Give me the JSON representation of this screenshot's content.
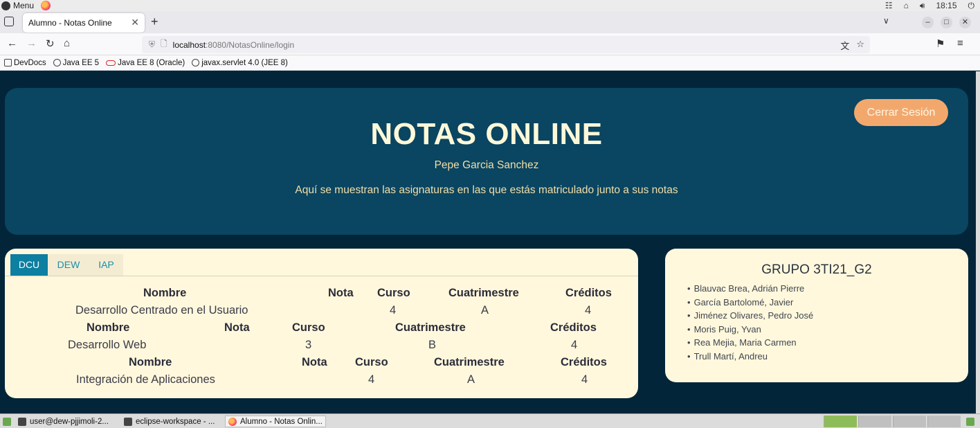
{
  "os": {
    "menu_label": "Menu",
    "time": "18:15"
  },
  "browser": {
    "tab_title": "Alumno - Notas Online",
    "url_host": "localhost",
    "url_rest": ":8080/NotasOnline/login",
    "bookmarks": [
      "DevDocs",
      "Java EE 5",
      "Java EE 8 (Oracle)",
      "javax.servlet 4.0 (JEE 8)"
    ]
  },
  "header": {
    "logout_label": "Cerrar Sesión",
    "title": "NOTAS ONLINE",
    "student_name": "Pepe Garcia Sanchez",
    "description": "Aquí se muestran las asignaturas en las que estás matriculado junto a sus notas"
  },
  "subjects": {
    "tabs": [
      "DCU",
      "DEW",
      "IAP"
    ],
    "active_tab": "DCU",
    "headers": {
      "nombre": "Nombre",
      "nota": "Nota",
      "curso": "Curso",
      "cuatrimestre": "Cuatrimestre",
      "creditos": "Créditos"
    },
    "rows": [
      {
        "nombre": "Desarrollo Centrado en el Usuario",
        "nota": "",
        "curso": "4",
        "cuatrimestre": "A",
        "creditos": "4"
      },
      {
        "nombre": "Desarrollo Web",
        "nota": "",
        "curso": "3",
        "cuatrimestre": "B",
        "creditos": "4"
      },
      {
        "nombre": "Integración de Aplicaciones",
        "nota": "",
        "curso": "4",
        "cuatrimestre": "A",
        "creditos": "4"
      }
    ]
  },
  "group": {
    "title": "GRUPO 3TI21_G2",
    "members": [
      "Blauvac Brea, Adrián Pierre",
      "García Bartolomé, Javier",
      "Jiménez Olivares, Pedro José",
      "Moris Puig, Yvan",
      "Rea Mejia, Maria Carmen",
      "Trull Martí, Andreu"
    ]
  },
  "taskbar": {
    "items": [
      "user@dew-pjjimoli-2...",
      "eclipse-workspace - ...",
      "Alumno - Notas Onlin..."
    ]
  },
  "colors": {
    "page_bg": "#02253a",
    "header_bg": "#0a4561",
    "card_bg": "#fff8dc",
    "accent_orange": "#f2a86d",
    "tab_active": "#0d7fa1"
  }
}
